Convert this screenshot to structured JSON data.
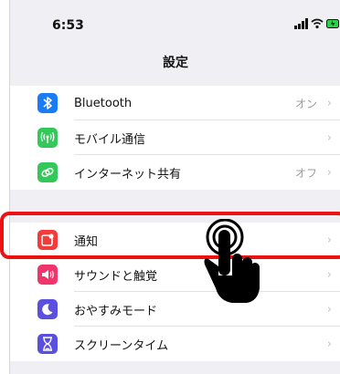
{
  "status_bar": {
    "time": "6:53"
  },
  "title": "設定",
  "group1": [
    {
      "name": "bluetooth",
      "label": "Bluetooth",
      "value": "オン",
      "icon": "bluetooth-icon",
      "color": "#1a7cf5"
    },
    {
      "name": "mobile-data",
      "label": "モバイル通信",
      "value": "",
      "icon": "antenna-icon",
      "color": "#34c759"
    },
    {
      "name": "hotspot",
      "label": "インターネット共有",
      "value": "オフ",
      "icon": "link-icon",
      "color": "#34c759"
    }
  ],
  "group2": [
    {
      "name": "notifications",
      "label": "通知",
      "value": "",
      "icon": "notification-icon",
      "color": "#f23b3b"
    },
    {
      "name": "sounds",
      "label": "サウンドと触覚",
      "value": "",
      "icon": "speaker-icon",
      "color": "#f0356c"
    },
    {
      "name": "do-not-disturb",
      "label": "おやすみモード",
      "value": "",
      "icon": "moon-icon",
      "color": "#5b4fe0"
    },
    {
      "name": "screen-time",
      "label": "スクリーンタイム",
      "value": "",
      "icon": "hourglass-icon",
      "color": "#5b4fe0"
    }
  ],
  "chevron": "›",
  "annotation": {
    "highlight_color": "#ee1111",
    "pointer": "tap-hand-icon"
  }
}
